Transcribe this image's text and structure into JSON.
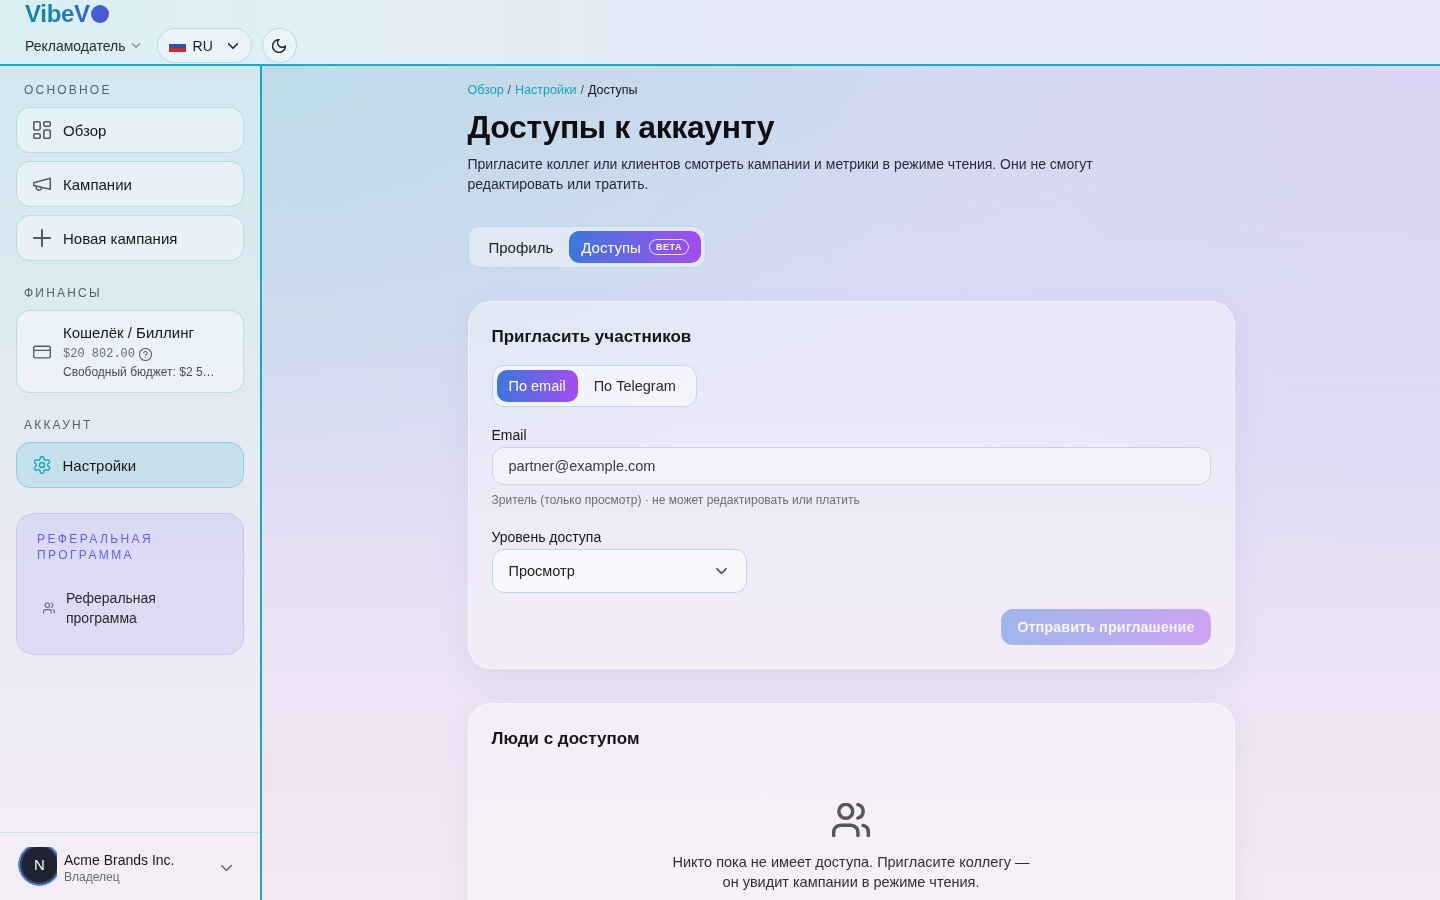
{
  "header": {
    "logo": "VibeV",
    "role_menu": {
      "label": "Рекламодатель"
    },
    "language": {
      "label": "RU"
    }
  },
  "sidebar": {
    "sections": [
      {
        "title": "ОСНОВНОЕ",
        "items": [
          {
            "kind": "link",
            "label": "Обзор",
            "selected": false
          },
          {
            "kind": "link",
            "label": "Кампании",
            "selected": false
          },
          {
            "kind": "link",
            "label": "Новая кампания",
            "selected": false
          }
        ]
      },
      {
        "title": "ФИНАНСЫ",
        "items": [
          {
            "kind": "wallet",
            "label": "Кошелёк / Биллинг",
            "balance": "$20 802.00",
            "note": "Свободный бюджет: $2 5…",
            "selected": false
          }
        ]
      },
      {
        "title": "АККАУНТ",
        "items": [
          {
            "kind": "link",
            "label": "Настройки",
            "selected": true
          }
        ]
      }
    ],
    "referral": {
      "title": "РЕФЕРАЛЬНАЯ ПРОГРАММА",
      "link": "Реферальная программа"
    },
    "account": {
      "avatar": "N",
      "name": "Acme Brands Inc.",
      "role": "Владелец"
    }
  },
  "breadcrumb": [
    {
      "kind": "link",
      "text": "Обзор"
    },
    {
      "kind": "separator",
      "text": "/"
    },
    {
      "kind": "link",
      "text": "Настройки"
    },
    {
      "kind": "separator",
      "text": "/"
    },
    {
      "kind": "current",
      "text": "Доступы"
    }
  ],
  "page": {
    "title": "Доступы к аккаунту",
    "description": "Пригласите коллег или клиентов смотреть кампании и метрики в режиме чтения. Они не смогут редактировать или тратить."
  },
  "tabs": [
    {
      "label": "Профиль",
      "selected": false
    },
    {
      "label": "Доступы",
      "badge": "BETA",
      "selected": true
    }
  ],
  "invite": {
    "title": "Пригласить участников",
    "methods": [
      {
        "label": "По email",
        "selected": true
      },
      {
        "label": "По Telegram",
        "selected": false
      }
    ],
    "email": {
      "label": "Email",
      "placeholder": "partner@example.com",
      "hint": "Зритель (только просмотр) · не может редактировать или платить"
    },
    "access_level": {
      "label": "Уровень доступа",
      "value": "Просмотр"
    },
    "send_button": {
      "label": "Отправить приглашение",
      "disabled": true
    }
  },
  "people": {
    "title": "Люди с доступом",
    "empty_message": "Никто пока не имеет доступа. Пригласите коллегу — он увидит кампании в режиме чтения."
  }
}
